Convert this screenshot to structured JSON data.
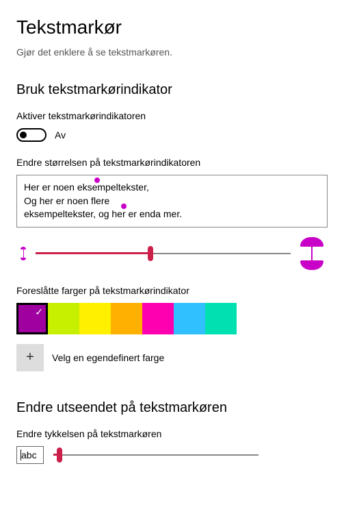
{
  "page": {
    "title": "Tekstmarkør",
    "subtitle": "Gjør det enklere å se tekstmarkøren."
  },
  "indicator": {
    "heading": "Bruk tekstmarkørindikator",
    "enable_label": "Aktiver tekstmarkørindikatoren",
    "toggle_state": "Av",
    "size_label": "Endre størrelsen på tekstmarkørindikatoren",
    "example_line1": "Her er noen eksempeltekster,",
    "example_line2": "Og her er noen flere",
    "example_line3": "eksempeltekster, og her er enda mer.",
    "size_slider": {
      "value_pct": 45
    },
    "colors_label": "Foreslåtte farger på tekstmarkørindikator",
    "swatches": [
      {
        "name": "purple",
        "hex": "#a000a0",
        "selected": true
      },
      {
        "name": "lime",
        "hex": "#c6f000",
        "selected": false
      },
      {
        "name": "yellow",
        "hex": "#fff000",
        "selected": false
      },
      {
        "name": "orange",
        "hex": "#ffb000",
        "selected": false
      },
      {
        "name": "magenta",
        "hex": "#ff00b0",
        "selected": false
      },
      {
        "name": "skyblue",
        "hex": "#30c0ff",
        "selected": false
      },
      {
        "name": "aqua",
        "hex": "#00e0b0",
        "selected": false
      }
    ],
    "custom_color_label": "Velg en egendefinert farge"
  },
  "appearance": {
    "heading": "Endre utseendet på tekstmarkøren",
    "thickness_label": "Endre tykkelsen på tekstmarkøren",
    "abc_sample": "abc",
    "thickness_slider": {
      "value_pct": 3
    }
  }
}
